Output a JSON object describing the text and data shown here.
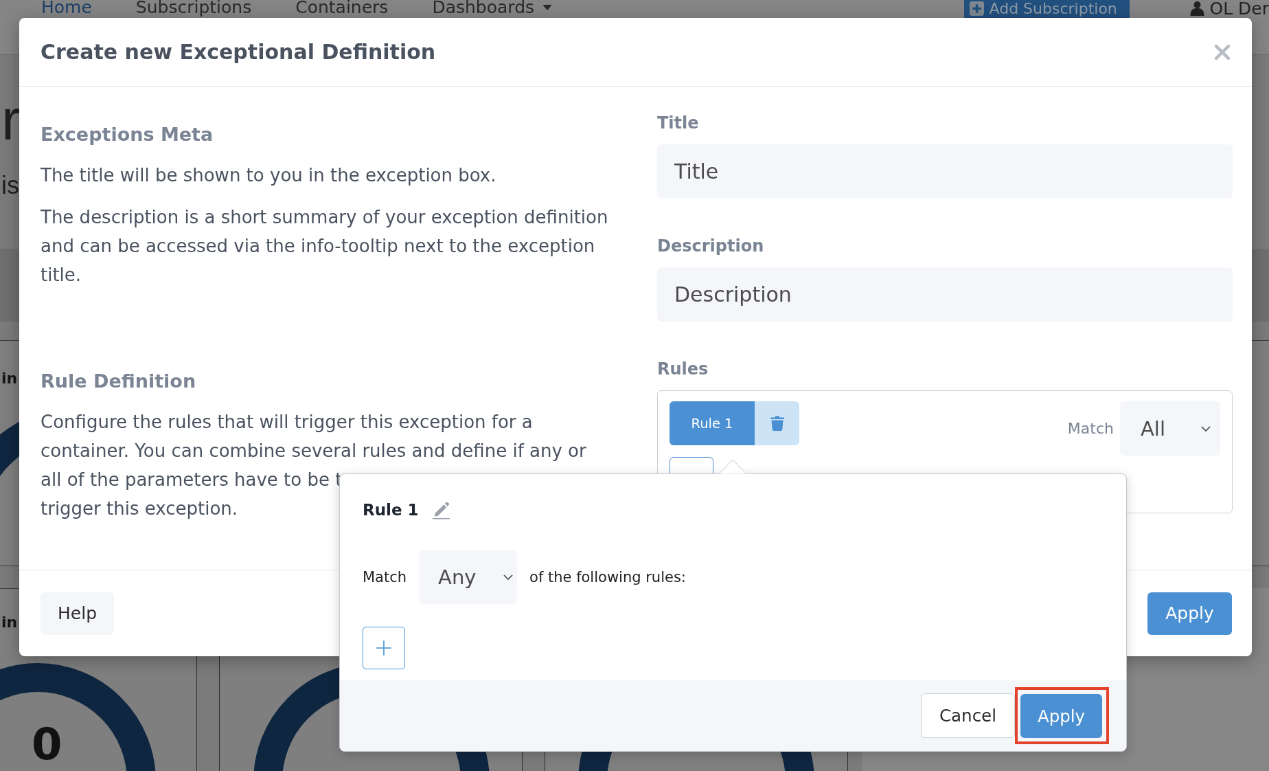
{
  "navbar": {
    "links": [
      {
        "label": "Home",
        "selected": true
      },
      {
        "label": "Subscriptions",
        "selected": false
      },
      {
        "label": "Containers",
        "selected": false
      },
      {
        "label": "Dashboards",
        "selected": false,
        "dropdown": true
      }
    ],
    "add_button": "Add Subscription",
    "user": "OL Der"
  },
  "dashboard": {
    "heading": "r",
    "subheading": "is",
    "panel_title": "in",
    "gauge_cards": [
      {
        "kind": "titled",
        "title": "in",
        "reading": "0"
      },
      {
        "kind": "plain"
      },
      {
        "kind": "plain"
      }
    ]
  },
  "modal": {
    "title": "Create new Exceptional Definition",
    "sections": [
      {
        "heading": "Exceptions Meta",
        "paragraphs": [
          {
            "parts": [
              [
                "The title will be shown to you in the exception box."
              ]
            ]
          },
          {
            "parts": [
              [
                "The description is a short summary of your exception definition",
                "and can be accessed via the info-tooltip next to the exception",
                "title."
              ]
            ]
          }
        ]
      },
      {
        "heading": "Rule Definition",
        "paragraphs": [
          {
            "parts": [
              [
                "Configure the rules that will trigger this exception for a",
                "container. You can combine several rules and define if any or"
              ],
              [
                "all of the parameters have to be t",
                "trigger this exception."
              ]
            ]
          }
        ]
      }
    ],
    "fields": [
      {
        "label": "Title",
        "placeholder": "Title"
      },
      {
        "label": "Description",
        "placeholder": "Description"
      }
    ],
    "rules": {
      "label": "Rules",
      "tabs": [
        {
          "label": "Rule 1",
          "selected": true
        }
      ],
      "match_label": "Match",
      "match_value": "All"
    },
    "footer": {
      "help": "Help",
      "apply": "Apply"
    }
  },
  "popover": {
    "title": "Rule 1",
    "match_label": "Match",
    "match_value": "Any",
    "match_suffix": "of the following rules:",
    "buttons": [
      {
        "label": "Cancel",
        "kind": "secondary",
        "highlighted": false
      },
      {
        "label": "Apply",
        "kind": "primary",
        "highlighted": true
      }
    ]
  }
}
